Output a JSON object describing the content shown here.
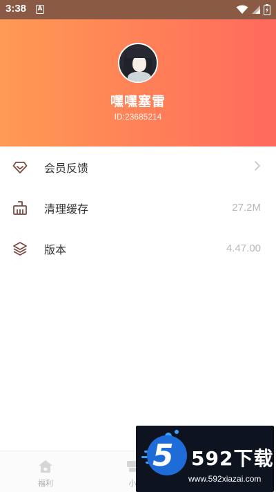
{
  "status_bar": {
    "time": "3:38",
    "notification_letter": "A"
  },
  "profile": {
    "username": "嘿嘿塞雷",
    "user_id": "ID:23685214"
  },
  "menu": {
    "items": [
      {
        "label": "会员反馈",
        "value": "",
        "icon": "diamond-icon",
        "has_chevron": true
      },
      {
        "label": "清理缓存",
        "value": "27.2M",
        "icon": "broom-icon",
        "has_chevron": false
      },
      {
        "label": "版本",
        "value": "4.47.00",
        "icon": "layers-icon",
        "has_chevron": false
      }
    ]
  },
  "tabbar": {
    "tabs": [
      {
        "label": "福利",
        "icon": "home-icon"
      },
      {
        "label": "小",
        "icon": "cup-icon"
      }
    ]
  },
  "watermark": {
    "logo_digit": "5",
    "brand": "592下载",
    "url": "www.592xiazai.com"
  },
  "colors": {
    "header_gradient_start": "#ff9a54",
    "header_gradient_end": "#ff6a5d",
    "status_bar": "#8a5a44",
    "icon_stroke": "#7a4a3e"
  }
}
